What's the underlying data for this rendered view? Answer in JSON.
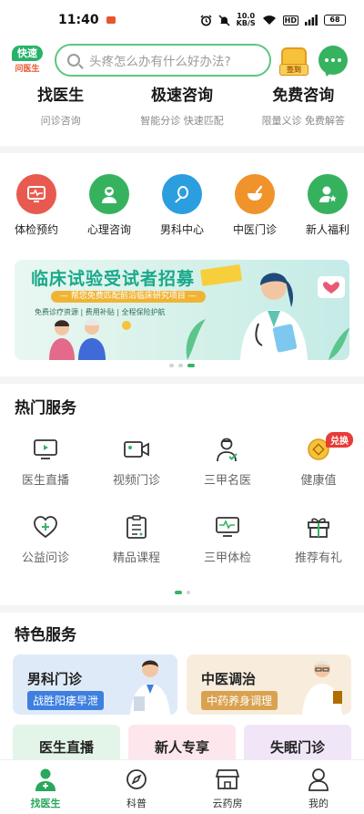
{
  "status_bar": {
    "time": "11:40",
    "speed_value": "10.0",
    "speed_unit": "KB/S",
    "network": "HD",
    "battery": "68"
  },
  "header": {
    "logo_line1": "快速",
    "logo_line2": "问医生",
    "search_placeholder": "头疼怎么办有什么好办法?",
    "signin_label": "签到"
  },
  "consult": [
    {
      "title": "找医生",
      "sub": "问诊咨询"
    },
    {
      "title": "极速咨询",
      "sub": "智能分诊 快速匹配"
    },
    {
      "title": "免费咨询",
      "sub": "限量义诊 免费解答"
    }
  ],
  "categories": [
    {
      "label": "体检预约",
      "color": "#e85a4f",
      "icon": "monitor-pulse-icon"
    },
    {
      "label": "心理咨询",
      "color": "#36b25f",
      "icon": "head-heart-icon"
    },
    {
      "label": "男科中心",
      "color": "#2b9ee0",
      "icon": "male-organ-icon"
    },
    {
      "label": "中医门诊",
      "color": "#f0932b",
      "icon": "mortar-icon"
    },
    {
      "label": "新人福利",
      "color": "#36b25f",
      "icon": "person-star-icon"
    }
  ],
  "banner": {
    "title": "临床试验受试者招募",
    "sub": "— 帮您免费匹配前沿临床研究项目 —",
    "tags": "免费诊疗资源 | 费用补贴 | 全程保险护航"
  },
  "hot_title": "热门服务",
  "hot_services": [
    {
      "label": "医生直播",
      "icon": "live-tv-icon"
    },
    {
      "label": "视频门诊",
      "icon": "video-camera-icon"
    },
    {
      "label": "三甲名医",
      "icon": "doctor-icon"
    },
    {
      "label": "健康值",
      "icon": "coin-icon",
      "badge": "兑换"
    },
    {
      "label": "公益问诊",
      "icon": "heart-plus-icon"
    },
    {
      "label": "精品课程",
      "icon": "clipboard-icon"
    },
    {
      "label": "三甲体检",
      "icon": "monitor-pulse-icon"
    },
    {
      "label": "推荐有礼",
      "icon": "gift-icon"
    }
  ],
  "feature_title": "特色服务",
  "features": [
    {
      "title": "男科门诊",
      "sub": "战胜阳痿早泄"
    },
    {
      "title": "中医调治",
      "sub": "中药养身调理"
    }
  ],
  "features_row2": [
    {
      "title": "医生直播"
    },
    {
      "title": "新人专享"
    },
    {
      "title": "失眠门诊"
    }
  ],
  "nav": [
    {
      "label": "找医生",
      "icon": "doctor-icon",
      "active": true
    },
    {
      "label": "科普",
      "icon": "compass-icon"
    },
    {
      "label": "云药房",
      "icon": "store-icon"
    },
    {
      "label": "我的",
      "icon": "user-icon"
    }
  ],
  "colors": {
    "brand": "#36b366",
    "badge": "#e83c37",
    "banner_title": "#1ba98b"
  }
}
